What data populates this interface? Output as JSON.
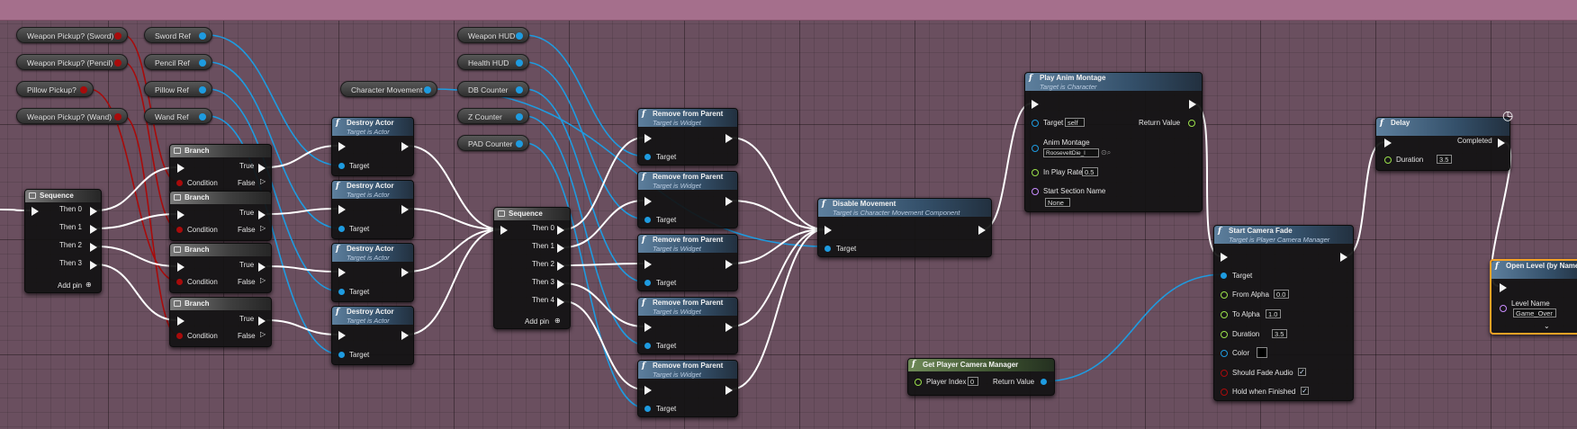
{
  "graph": {
    "variables": [
      {
        "id": "v1",
        "label": "Weapon Pickup? (Sword)",
        "type": "bool"
      },
      {
        "id": "v2",
        "label": "Weapon Pickup? (Pencil)",
        "type": "bool"
      },
      {
        "id": "v3",
        "label": "Pillow Pickup?",
        "type": "bool"
      },
      {
        "id": "v4",
        "label": "Weapon Pickup? (Wand)",
        "type": "bool"
      },
      {
        "id": "v5",
        "label": "Sword Ref",
        "type": "object"
      },
      {
        "id": "v6",
        "label": "Pencil Ref",
        "type": "object"
      },
      {
        "id": "v7",
        "label": "Pillow Ref",
        "type": "object"
      },
      {
        "id": "v8",
        "label": "Wand Ref",
        "type": "object"
      },
      {
        "id": "v9",
        "label": "Character Movement",
        "type": "object"
      },
      {
        "id": "v10",
        "label": "Weapon HUD",
        "type": "object"
      },
      {
        "id": "v11",
        "label": "Health HUD",
        "type": "object"
      },
      {
        "id": "v12",
        "label": "DB Counter",
        "type": "object"
      },
      {
        "id": "v13",
        "label": "Z Counter",
        "type": "object"
      },
      {
        "id": "v14",
        "label": "PAD Counter",
        "type": "object"
      }
    ],
    "seq1": {
      "title": "Sequence",
      "outputs": [
        "Then 0",
        "Then 1",
        "Then 2",
        "Then 3"
      ],
      "add_pin": "Add pin"
    },
    "branch": {
      "title": "Branch",
      "condition": "Condition",
      "true_label": "True",
      "false_label": "False"
    },
    "destroy": {
      "title": "Destroy Actor",
      "subtitle": "Target is Actor",
      "target": "Target"
    },
    "seq2": {
      "title": "Sequence",
      "outputs": [
        "Then 0",
        "Then 1",
        "Then 2",
        "Then 3",
        "Then 4"
      ],
      "add_pin": "Add pin"
    },
    "remove": {
      "title": "Remove from Parent",
      "subtitle": "Target is Widget",
      "target": "Target"
    },
    "disable": {
      "title": "Disable Movement",
      "subtitle": "Target is Character Movement Component",
      "target": "Target"
    },
    "montage": {
      "title": "Play Anim Montage",
      "subtitle": "Target is Character",
      "target": "Target",
      "target_value": "self",
      "return_value": "Return Value",
      "anim_montage": "Anim Montage",
      "anim_value": "RooseveltDie_l",
      "rate": "In Play Rate",
      "rate_value": "0.5",
      "section": "Start Section Name",
      "section_value": "None"
    },
    "camera_mgr": {
      "title": "Get Player Camera Manager",
      "player_index": "Player Index",
      "index_value": "0",
      "return_value": "Return Value"
    },
    "fade": {
      "title": "Start Camera Fade",
      "subtitle": "Target is Player Camera Manager",
      "target": "Target",
      "from_alpha": "From Alpha",
      "from_value": "0.0",
      "to_alpha": "To Alpha",
      "to_value": "1.0",
      "duration": "Duration",
      "duration_value": "3.5",
      "color": "Color",
      "fade_audio": "Should Fade Audio",
      "hold": "Hold when Finished"
    },
    "delay": {
      "title": "Delay",
      "completed": "Completed",
      "duration": "Duration",
      "duration_value": "3.5"
    },
    "open_level": {
      "title": "Open Level (by Name)",
      "level_name": "Level Name",
      "level_value": "Game_Over"
    },
    "colors": {
      "background": "#6a4f5f",
      "top_bar": "#a56f8c",
      "exec_wire": "#ffffff",
      "object_wire": "#1e9be0",
      "bool_wire": "#a80b0b",
      "float_pin": "#9ae04a",
      "name_pin": "#c98cff",
      "selection": "#f4a225"
    }
  }
}
